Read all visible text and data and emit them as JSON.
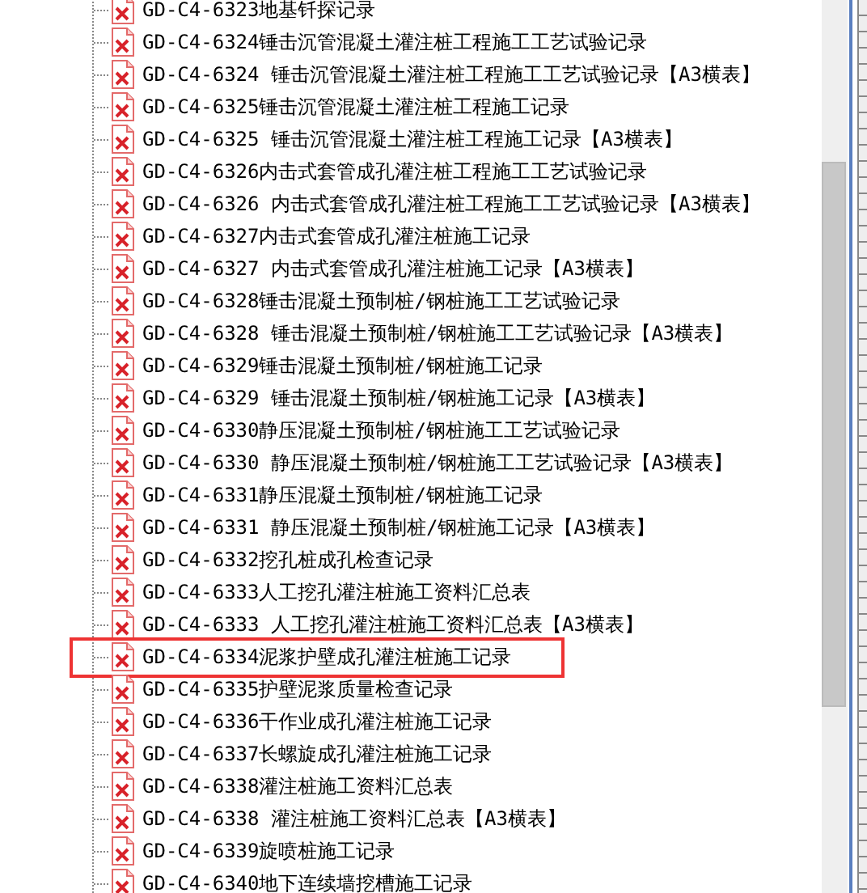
{
  "tree": {
    "items": [
      {
        "label": "GD-C4-6323地基钎探记录",
        "highlighted": false
      },
      {
        "label": "GD-C4-6324锤击沉管混凝土灌注桩工程施工工艺试验记录",
        "highlighted": false
      },
      {
        "label": "GD-C4-6324 锤击沉管混凝土灌注桩工程施工工艺试验记录【A3横表】",
        "highlighted": false
      },
      {
        "label": "GD-C4-6325锤击沉管混凝土灌注桩工程施工记录",
        "highlighted": false
      },
      {
        "label": "GD-C4-6325 锤击沉管混凝土灌注桩工程施工记录【A3横表】",
        "highlighted": false
      },
      {
        "label": "GD-C4-6326内击式套管成孔灌注桩工程施工工艺试验记录",
        "highlighted": false
      },
      {
        "label": "GD-C4-6326 内击式套管成孔灌注桩工程施工工艺试验记录【A3横表】",
        "highlighted": false
      },
      {
        "label": "GD-C4-6327内击式套管成孔灌注桩施工记录",
        "highlighted": false
      },
      {
        "label": "GD-C4-6327 内击式套管成孔灌注桩施工记录【A3横表】",
        "highlighted": false
      },
      {
        "label": "GD-C4-6328锤击混凝土预制桩/钢桩施工工艺试验记录",
        "highlighted": false
      },
      {
        "label": "GD-C4-6328 锤击混凝土预制桩/钢桩施工工艺试验记录【A3横表】",
        "highlighted": false
      },
      {
        "label": "GD-C4-6329锤击混凝土预制桩/钢桩施工记录",
        "highlighted": false
      },
      {
        "label": "GD-C4-6329 锤击混凝土预制桩/钢桩施工记录【A3横表】",
        "highlighted": false
      },
      {
        "label": "GD-C4-6330静压混凝土预制桩/钢桩施工工艺试验记录",
        "highlighted": false
      },
      {
        "label": "GD-C4-6330 静压混凝土预制桩/钢桩施工工艺试验记录【A3横表】",
        "highlighted": false
      },
      {
        "label": "GD-C4-6331静压混凝土预制桩/钢桩施工记录",
        "highlighted": false
      },
      {
        "label": "GD-C4-6331 静压混凝土预制桩/钢桩施工记录【A3横表】",
        "highlighted": false
      },
      {
        "label": "GD-C4-6332挖孔桩成孔检查记录",
        "highlighted": false
      },
      {
        "label": "GD-C4-6333人工挖孔灌注桩施工资料汇总表",
        "highlighted": false
      },
      {
        "label": "GD-C4-6333 人工挖孔灌注桩施工资料汇总表【A3横表】",
        "highlighted": false
      },
      {
        "label": "GD-C4-6334泥浆护壁成孔灌注桩施工记录",
        "highlighted": true
      },
      {
        "label": "GD-C4-6335护壁泥浆质量检查记录",
        "highlighted": false
      },
      {
        "label": "GD-C4-6336干作业成孔灌注桩施工记录",
        "highlighted": false
      },
      {
        "label": "GD-C4-6337长螺旋成孔灌注桩施工记录",
        "highlighted": false
      },
      {
        "label": "GD-C4-6338灌注桩施工资料汇总表",
        "highlighted": false
      },
      {
        "label": "GD-C4-6338 灌注桩施工资料汇总表【A3横表】",
        "highlighted": false
      },
      {
        "label": "GD-C4-6339旋喷桩施工记录",
        "highlighted": false
      },
      {
        "label": "GD-C4-6340地下连续墙挖槽施工记录",
        "highlighted": false
      }
    ]
  }
}
